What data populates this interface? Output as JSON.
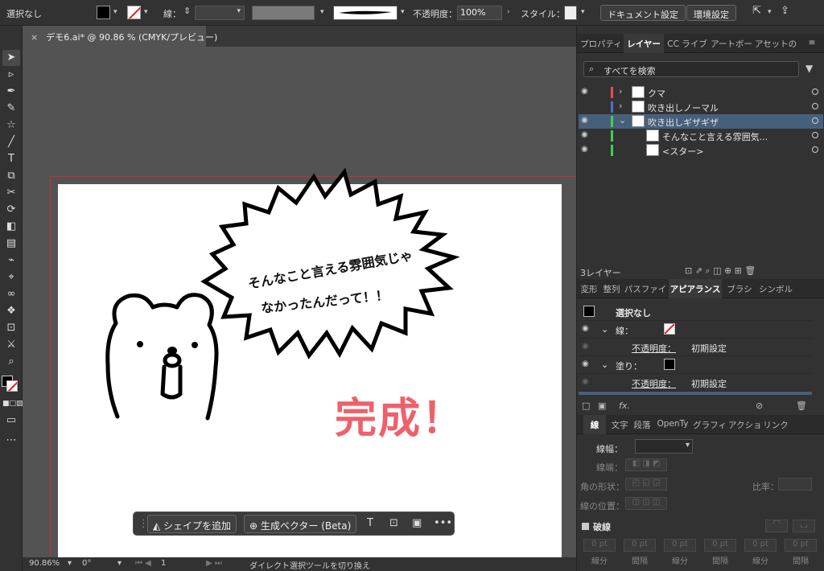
{
  "control_bar": {
    "selection": "選択なし",
    "stroke_label": "線：",
    "opacity_label": "不透明度：",
    "opacity_value": "100%",
    "style_label": "スタイル：",
    "doc_settings": "ドキュメント設定",
    "preferences": "環境設定"
  },
  "document_tab": {
    "close": "×",
    "title": "デモ6.ai* @ 90.86 % (CMYK/プレビュー)"
  },
  "artwork": {
    "speech_line1": "そんなこと言える雰囲気じゃ",
    "speech_line2": "なかったんだって！！",
    "complete_text": "完成！"
  },
  "context_bar": {
    "add_shape": "シェイプを追加",
    "gen_vector": "生成ベクター (Beta)"
  },
  "status_bar": {
    "zoom": "90.86%",
    "angle": "0°",
    "artboard": "1",
    "tool_hint": "ダイレクト選択ツールを切り換え"
  },
  "panels_top": {
    "tabs": [
      "プロパティ",
      "レイヤー",
      "CC ライブ",
      "アートボー",
      "アセットの"
    ],
    "active_tab": 1,
    "search_placeholder": "すべてを検索",
    "layers": [
      {
        "name": "クマ",
        "color": "#e05050",
        "visible": true,
        "expanded": false,
        "indent": 0
      },
      {
        "name": "吹き出しノーマル",
        "color": "#4a6fd6",
        "visible": false,
        "expanded": false,
        "indent": 0
      },
      {
        "name": "吹き出しギザギザ",
        "color": "#40d050",
        "visible": true,
        "expanded": true,
        "indent": 0,
        "selected": true
      },
      {
        "name": "そんなこと言える雰囲気...",
        "color": "#40d050",
        "visible": true,
        "indent": 1
      },
      {
        "name": "<スター>",
        "color": "#40d050",
        "visible": true,
        "indent": 1
      }
    ],
    "layer_count": "3レイヤー"
  },
  "panels_mid": {
    "tabs": [
      "変形",
      "整列",
      "パスファイ",
      "アピアランス",
      "ブラシ",
      "シンボル"
    ],
    "active_tab": 3,
    "header": "選択なし",
    "stroke_label": "線：",
    "opacity_label": "不透明度：",
    "opacity_value": "初期設定",
    "fill_label": "塗り：",
    "opacity2_value": "初期設定"
  },
  "panels_bottom": {
    "tabs": [
      "線",
      "文字",
      "段落",
      "OpenTy",
      "グラフィ",
      "アクショ",
      "リンク"
    ],
    "active_tab": 0,
    "weight_label": "線幅：",
    "cap_label": "線端：",
    "corner_label": "角の形状：",
    "limit_label": "比率：",
    "align_label": "線の位置：",
    "dash_label": "破線",
    "dash_cols": [
      "線分",
      "間隔",
      "線分",
      "間隔",
      "線分",
      "間隔"
    ],
    "pt": "0 pt"
  },
  "colors": {
    "accent_text": "#f0606a",
    "bleed": "#c8302a",
    "selected_row": "#46607c"
  }
}
